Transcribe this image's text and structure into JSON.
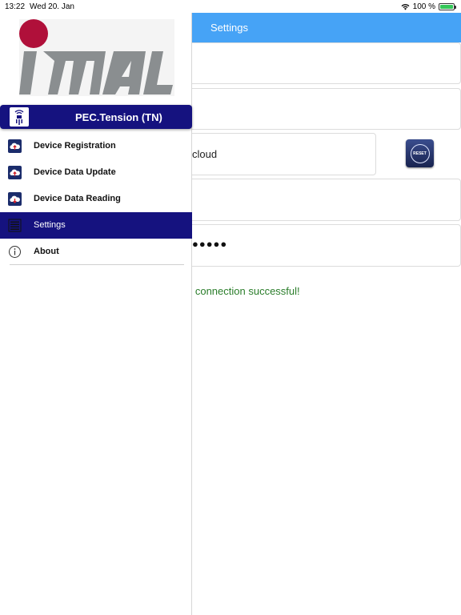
{
  "status_bar": {
    "time": "13:22",
    "date": "Wed 20. Jan",
    "battery": "100 %",
    "battery_level": 1.0
  },
  "main": {
    "title": "Settings",
    "field3_value": "cloud",
    "field5_value": "●●●●●",
    "reset_label": "RESET",
    "status_message": "d connection successful!",
    "colors": {
      "navbar": "#46a3f6",
      "status": "#2a7d2a"
    }
  },
  "drawer": {
    "title": "PEC.Tension (TN)",
    "header_color": "#15127f",
    "logo_text": "IMAL",
    "items": [
      {
        "label": "Device Registration",
        "icon": "cloud-icon"
      },
      {
        "label": "Device Data Update",
        "icon": "cloud-icon"
      },
      {
        "label": "Device Data Reading",
        "icon": "cloud-icon"
      },
      {
        "label": "Settings",
        "icon": "list-icon",
        "active": true
      },
      {
        "label": "About",
        "icon": "info-icon"
      }
    ]
  }
}
